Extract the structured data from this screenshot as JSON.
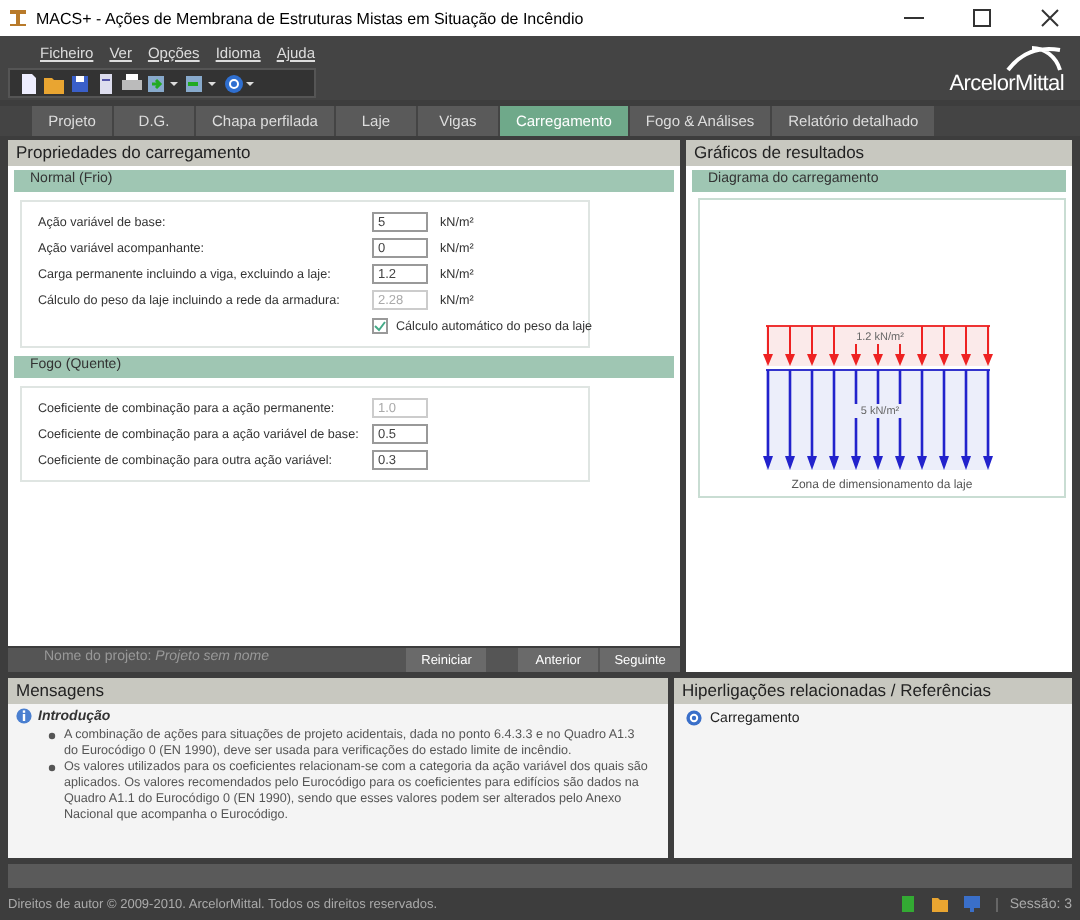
{
  "window": {
    "title": "MACS+ - Ações de Membrana de Estruturas Mistas em Situação de Incêndio"
  },
  "menu": [
    "Ficheiro",
    "Ver",
    "Opções",
    "Idioma",
    "Ajuda"
  ],
  "logo": "ArcelorMittal",
  "tabs": [
    {
      "label": "Projeto",
      "selected": false
    },
    {
      "label": "D.G.",
      "selected": false
    },
    {
      "label": "Chapa perfilada",
      "selected": false
    },
    {
      "label": "Laje",
      "selected": false
    },
    {
      "label": "Vigas",
      "selected": false
    },
    {
      "label": "Carregamento",
      "selected": true
    },
    {
      "label": "Fogo & Análises",
      "selected": false
    },
    {
      "label": "Relatório detalhado",
      "selected": false
    }
  ],
  "properties_panel": {
    "title": "Propriedades do carregamento",
    "sections": [
      {
        "title": "Normal (Frio)",
        "fields": [
          {
            "label": "Ação variável de base:",
            "value": "5",
            "unit": "kN/m²",
            "disabled": false
          },
          {
            "label": "Ação variável acompanhante:",
            "value": "0",
            "unit": "kN/m²",
            "disabled": false
          },
          {
            "label": "Carga permanente incluindo a viga, excluindo a laje:",
            "value": "1.2",
            "unit": "kN/m²",
            "disabled": false
          },
          {
            "label": "Cálculo do peso da laje incluindo a rede da armadura:",
            "value": "2.28",
            "unit": "kN/m²",
            "disabled": true
          }
        ],
        "checkbox": {
          "label": "Cálculo automático do peso da laje",
          "checked": true
        }
      },
      {
        "title": "Fogo (Quente)",
        "fields": [
          {
            "label": "Coeficiente de combinação para a ação permanente:",
            "value": "1.0",
            "disabled": true
          },
          {
            "label": "Coeficiente de combinação para a ação variável de base:",
            "value": "0.5",
            "disabled": false
          },
          {
            "label": "Coeficiente de combinação para outra ação variável:",
            "value": "0.3",
            "disabled": false
          }
        ]
      }
    ]
  },
  "results_panel": {
    "title": "Gráficos de resultados",
    "section_title": "Diagrama do carregamento",
    "diagram": {
      "permanent_load": "1.2 kN/m²",
      "variable_load": "5 kN/m²",
      "caption": "Zona de dimensionamento da laje"
    }
  },
  "navigation": {
    "project_label": "Nome do projeto:",
    "project_name": "Projeto sem nome",
    "buttons": [
      "Reiniciar",
      "Anterior",
      "Seguinte"
    ]
  },
  "messages": {
    "title": "Mensagens",
    "heading": "Introdução",
    "bullets": [
      "A combinação de ações para situações de projeto acidentais, dada no ponto 6.4.3.3 e no Quadro A1.3 do Eurocódigo 0 (EN 1990), deve ser usada para verificações do estado limite de incêndio.",
      "Os valores utilizados para os coeficientes relacionam-se com a categoria da ação variável dos quais são aplicados. Os valores recomendados pelo Eurocódigo para os coeficientes para edifícios são dados na Quadro A1.1 do Eurocódigo 0 (EN 1990), sendo que esses valores podem ser alterados pelo Anexo Nacional que acompanha o Eurocódigo."
    ]
  },
  "links": {
    "title": "Hiperligações relacionadas / Referências",
    "items": [
      "Carregamento"
    ]
  },
  "status_bar": {
    "copyright": "Direitos de autor © 2009-2010. ArcelorMittal. Todos os direitos reservados.",
    "session": "Sessão: 3"
  }
}
